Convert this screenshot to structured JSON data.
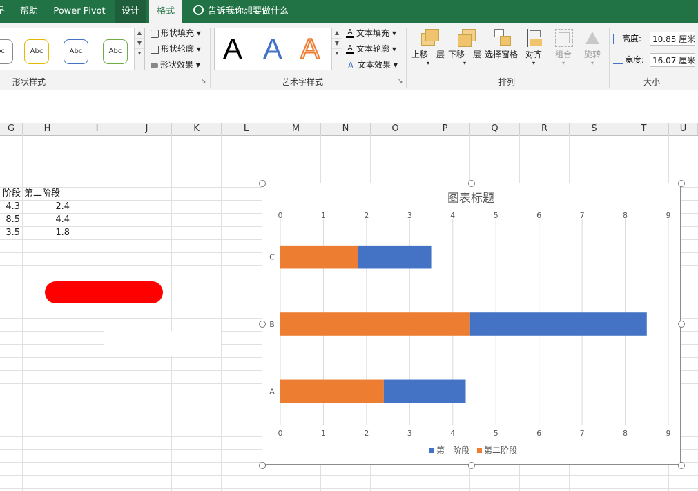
{
  "tabs": [
    {
      "label": "是",
      "active": false
    },
    {
      "label": "帮助",
      "active": false
    },
    {
      "label": "Power Pivot",
      "active": false
    },
    {
      "label": "设计",
      "active": false
    },
    {
      "label": "格式",
      "active": true
    }
  ],
  "tell_me": {
    "placeholder": "告诉我你想要做什么"
  },
  "ribbon": {
    "shape_styles": {
      "label": "形状样式",
      "presets": [
        "bc",
        "Abc",
        "Abc",
        "Abc"
      ],
      "fill": "形状填充",
      "outline": "形状轮廓",
      "effects": "形状效果"
    },
    "wordart_styles": {
      "label": "艺术字样式",
      "presets": [
        "A",
        "A",
        "A"
      ],
      "text_fill": "文本填充",
      "text_outline": "文本轮廓",
      "text_effects": "文本效果"
    },
    "arrange": {
      "label": "排列",
      "bring_forward": "上移一层",
      "send_backward": "下移一层",
      "selection_pane": "选择窗格",
      "align": "对齐",
      "group": "组合",
      "rotate": "旋转"
    },
    "size": {
      "label": "大小",
      "height_label": "高度:",
      "height_value": "10.85 厘米",
      "width_label": "宽度:",
      "width_value": "16.07 厘米"
    }
  },
  "columns": [
    "G",
    "H",
    "I",
    "J",
    "K",
    "L",
    "M",
    "N",
    "O",
    "P",
    "Q",
    "R",
    "S",
    "T",
    "U"
  ],
  "sheet": {
    "header_g": "阶段",
    "header_h": "第二阶段",
    "rows": [
      {
        "g": "4.3",
        "h": "2.4"
      },
      {
        "g": "8.5",
        "h": "4.4"
      },
      {
        "g": "3.5",
        "h": "1.8"
      }
    ]
  },
  "colors": {
    "excel_green": "#217346",
    "series_blue": "#4472c4",
    "series_orange": "#ed7d31",
    "red_shape": "#ff0000"
  },
  "chart_data": {
    "type": "bar",
    "title": "图表标题",
    "orientation": "horizontal",
    "stacked": true,
    "categories": [
      "A",
      "B",
      "C"
    ],
    "series": [
      {
        "name": "第一阶段",
        "values": [
          1.9,
          4.1,
          1.7
        ],
        "color": "#4472c4"
      },
      {
        "name": "第二阶段",
        "values": [
          2.4,
          4.4,
          1.8
        ],
        "color": "#ed7d31"
      }
    ],
    "xlim": [
      0,
      9
    ],
    "ticks": [
      "0",
      "1",
      "2",
      "3",
      "4",
      "5",
      "6",
      "7",
      "8",
      "9"
    ],
    "grid": true,
    "legend_position": "bottom"
  }
}
